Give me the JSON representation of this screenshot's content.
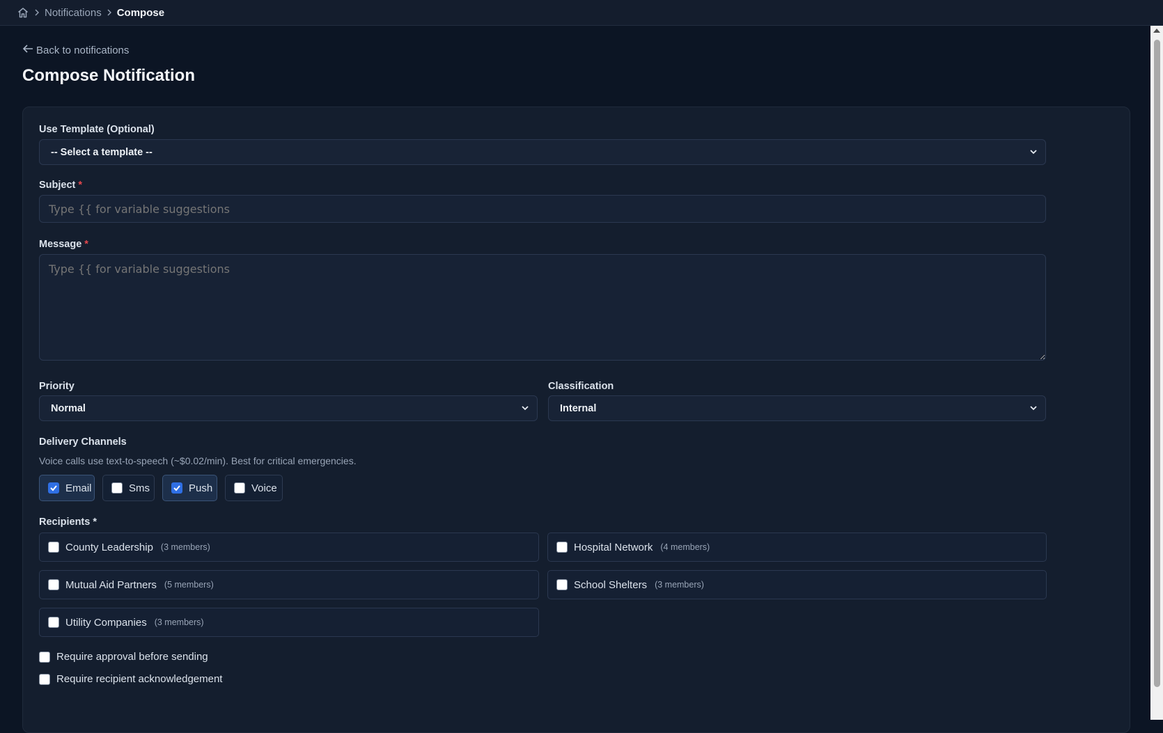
{
  "breadcrumb": {
    "home_icon": "home-icon",
    "items": [
      "Notifications",
      "Compose"
    ]
  },
  "back_link": "Back to notifications",
  "page_title": "Compose Notification",
  "form": {
    "template": {
      "label": "Use Template (Optional)",
      "value": "-- Select a template --"
    },
    "subject": {
      "label": "Subject",
      "required_mark": "*",
      "placeholder": "Type {{ for variable suggestions"
    },
    "message": {
      "label": "Message",
      "required_mark": "*",
      "placeholder": "Type {{ for variable suggestions"
    },
    "priority": {
      "label": "Priority",
      "value": "Normal"
    },
    "classification": {
      "label": "Classification",
      "value": "Internal"
    },
    "delivery": {
      "label": "Delivery Channels",
      "hint": "Voice calls use text-to-speech (~$0.02/min). Best for critical emergencies.",
      "channels": [
        {
          "label": "Email",
          "checked": true
        },
        {
          "label": "Sms",
          "checked": false
        },
        {
          "label": "Push",
          "checked": true
        },
        {
          "label": "Voice",
          "checked": false
        }
      ]
    },
    "recipients": {
      "label": "Recipients *",
      "groups": [
        {
          "name": "County Leadership",
          "count": "(3 members)"
        },
        {
          "name": "Hospital Network",
          "count": "(4 members)"
        },
        {
          "name": "Mutual Aid Partners",
          "count": "(5 members)"
        },
        {
          "name": "School Shelters",
          "count": "(3 members)"
        },
        {
          "name": "Utility Companies",
          "count": "(3 members)"
        }
      ]
    },
    "options": [
      {
        "label": "Require approval before sending",
        "checked": false
      },
      {
        "label": "Require recipient acknowledgement",
        "checked": false
      }
    ]
  },
  "colors": {
    "accent": "#2f6fe4",
    "required": "#e5484d",
    "background": "#0c1524",
    "card": "#141e2e"
  }
}
